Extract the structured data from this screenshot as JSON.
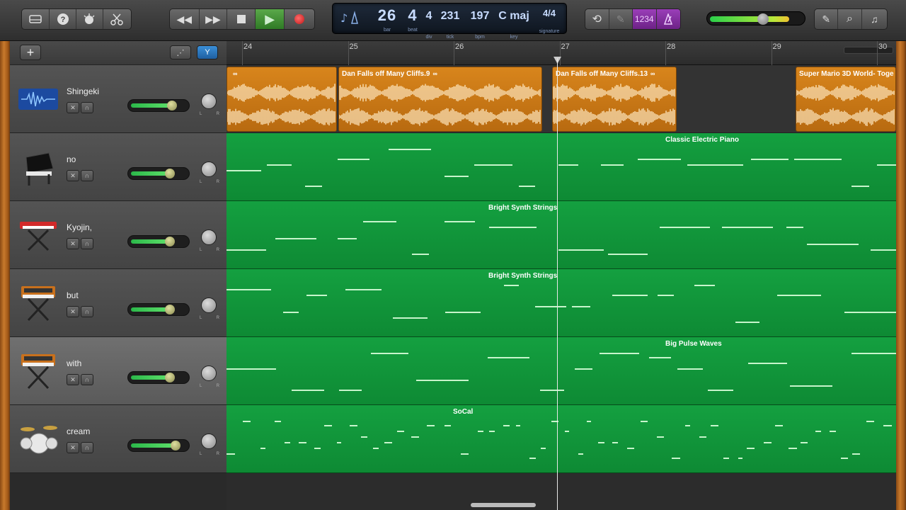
{
  "lcd": {
    "bar": "26",
    "beat": "4",
    "div": "4",
    "tick": "231",
    "bpm": "197",
    "key": "C maj",
    "signature": "4/4",
    "labels": {
      "bar": "bar",
      "beat": "beat",
      "div": "div",
      "tick": "tick",
      "bpm": "bpm",
      "key": "key",
      "signature": "signature"
    }
  },
  "toolbar": {
    "count_in": "1234"
  },
  "ruler": {
    "bars": [
      "24",
      "25",
      "26",
      "27",
      "28",
      "29",
      "30"
    ]
  },
  "pan_labels": {
    "left": "L",
    "right": "R"
  },
  "master_volume": 0.56,
  "tracks": [
    {
      "name": "Shingeki",
      "icon": "audio-waveform-icon",
      "volume": 0.75
    },
    {
      "name": "no",
      "icon": "grand-piano-icon",
      "volume": 0.7
    },
    {
      "name": "Kyojin,",
      "icon": "keyboard-stand-icon",
      "volume": 0.7
    },
    {
      "name": "but",
      "icon": "synth-stand-icon",
      "volume": 0.7
    },
    {
      "name": "with",
      "icon": "synth-stand-icon",
      "volume": 0.7
    },
    {
      "name": "cream",
      "icon": "drum-kit-icon",
      "volume": 0.82
    }
  ],
  "regions": {
    "audio": [
      {
        "title": ""
      },
      {
        "title": "Dan Falls off Many Cliffs.9"
      },
      {
        "title": "Dan Falls off Many Cliffs.13"
      },
      {
        "title": "Super Mario 3D World- Toge"
      }
    ],
    "midi": [
      {
        "title": "Classic Electric Piano"
      },
      {
        "title": "Bright Synth Strings"
      },
      {
        "title": "Bright Synth Strings"
      },
      {
        "title": "Big Pulse Waves"
      },
      {
        "title": "SoCal"
      }
    ]
  },
  "colors": {
    "audio_region": "#d8851c",
    "midi_region": "#14a040",
    "play": "#5aa84a",
    "record": "#c01818",
    "accent_purple": "#9a3fb8"
  }
}
